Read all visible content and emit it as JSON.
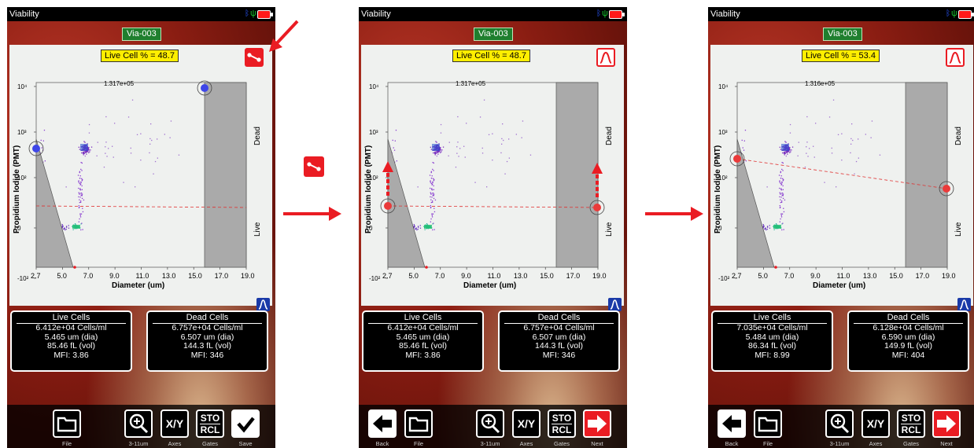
{
  "screens": [
    {
      "title": "Viability",
      "sample": "Via-003",
      "live_pct_label": "Live Cell % = 48.7",
      "top_label": "1.317e+05",
      "gate_button": "line-gate-icon",
      "live_cells": {
        "header": "Live Cells",
        "conc": "6.412e+04 Cells/ml",
        "dia": "5.465 um (dia)",
        "vol": "85.46 fL (vol)",
        "mfi": "MFI:  3.86"
      },
      "dead_cells": {
        "header": "Dead Cells",
        "conc": "6.757e+04 Cells/ml",
        "dia": "6.507 um (dia)",
        "vol": "144.3 fL (vol)",
        "mfi": "MFI:  346"
      },
      "buttons": {
        "file": "File",
        "zoom": "3-11um",
        "axes": "Axes",
        "gates": "Gates",
        "save": "Save"
      }
    },
    {
      "title": "Viability",
      "sample": "Via-003",
      "live_pct_label": "Live Cell % = 48.7",
      "top_label": "1.317e+05",
      "gate_button": "curve-gate-icon",
      "live_cells": {
        "header": "Live Cells",
        "conc": "6.412e+04 Cells/ml",
        "dia": "5.465 um (dia)",
        "vol": "85.46 fL (vol)",
        "mfi": "MFI:  3.86"
      },
      "dead_cells": {
        "header": "Dead Cells",
        "conc": "6.757e+04 Cells/ml",
        "dia": "6.507 um (dia)",
        "vol": "144.3 fL (vol)",
        "mfi": "MFI:  346"
      },
      "buttons": {
        "back": "Back",
        "file": "File",
        "zoom": "3-11um",
        "axes": "Axes",
        "gates": "Gates",
        "next": "Next"
      }
    },
    {
      "title": "Viability",
      "sample": "Via-003",
      "live_pct_label": "Live Cell % = 53.4",
      "top_label": "1.316e+05",
      "gate_button": "curve-gate-icon",
      "live_cells": {
        "header": "Live Cells",
        "conc": "7.035e+04 Cells/ml",
        "dia": "5.484 um (dia)",
        "vol": "86.34 fL (vol)",
        "mfi": "MFI:  8.99"
      },
      "dead_cells": {
        "header": "Dead Cells",
        "conc": "6.128e+04 Cells/ml",
        "dia": "6.590 um (dia)",
        "vol": "149.9 fL (vol)",
        "mfi": "MFI:  404"
      },
      "buttons": {
        "back": "Back",
        "file": "File",
        "zoom": "3-11um",
        "axes": "Axes",
        "gates": "Gates",
        "next": "Next"
      }
    }
  ],
  "axes": {
    "ylabel": "Propidium Iodide (PMT)",
    "xlabel": "Diameter (um)",
    "xticks": [
      "2.7",
      "5.0",
      "7.0",
      "9.0",
      "11.0",
      "13.0",
      "15.0",
      "17.0",
      "19.0"
    ],
    "right_top": "Dead",
    "right_bottom": "Live"
  },
  "colors": {
    "accent_red": "#ea1c23",
    "badge_green": "#1f7f2e",
    "highlight_yellow": "#ffee00"
  }
}
